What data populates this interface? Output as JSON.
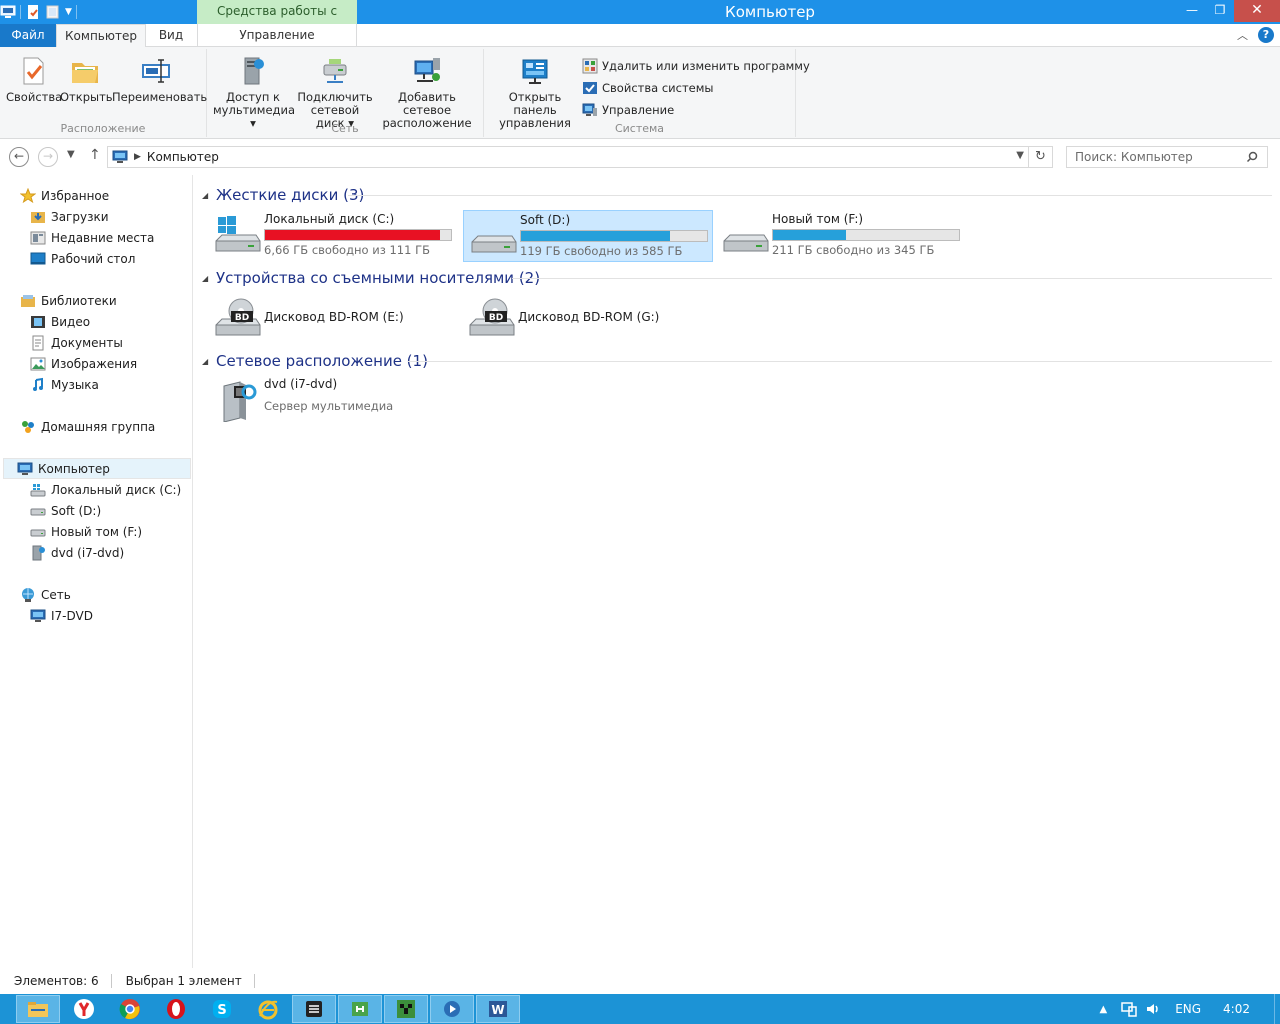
{
  "window": {
    "title": "Компьютер",
    "tools_tab_label": "Средства работы с дисками",
    "minimize": "—",
    "maximize": "❐",
    "close": "✕"
  },
  "tabs": {
    "file": "Файл",
    "computer": "Компьютер",
    "view": "Вид",
    "manage": "Управление",
    "help": "?"
  },
  "ribbon": {
    "location": {
      "label": "Расположение",
      "properties": "Свойства",
      "open": "Открыть",
      "rename": "Переименовать"
    },
    "network": {
      "label": "Сеть",
      "media_access_line1": "Доступ к",
      "media_access_line2": "мультимедиа",
      "map_drive_line1": "Подключить",
      "map_drive_line2": "сетевой диск",
      "add_location_line1": "Добавить сетевое",
      "add_location_line2": "расположение"
    },
    "system": {
      "label": "Система",
      "control_panel_line1": "Открыть панель",
      "control_panel_line2": "управления",
      "uninstall": "Удалить или изменить программу",
      "system_properties": "Свойства системы",
      "manage": "Управление"
    }
  },
  "address": {
    "crumb": "Компьютер",
    "search_placeholder": "Поиск: Компьютер"
  },
  "nav": {
    "favorites": "Избранное",
    "downloads": "Загрузки",
    "recent": "Недавние места",
    "desktop": "Рабочий стол",
    "libraries": "Библиотеки",
    "video": "Видео",
    "documents": "Документы",
    "pictures": "Изображения",
    "music": "Музыка",
    "homegroup": "Домашняя группа",
    "computer": "Компьютер",
    "drive_c": "Локальный диск (C:)",
    "drive_d": "Soft (D:)",
    "drive_f": "Новый том (F:)",
    "dvd": "dvd (i7-dvd)",
    "network": "Сеть",
    "i7dvd": "I7-DVD"
  },
  "groups": {
    "hard_disks": "Жесткие диски (3)",
    "removable": "Устройства со съемными носителями (2)",
    "network": "Сетевое расположение (1)"
  },
  "drives": [
    {
      "name": "Локальный диск (C:)",
      "free_text": "6,66 ГБ свободно из 111 ГБ",
      "used_fraction": 0.94,
      "bar_color": "#e81123"
    },
    {
      "name": "Soft (D:)",
      "free_text": "119 ГБ свободно из 585 ГБ",
      "used_fraction": 0.8,
      "bar_color": "#26a0da"
    },
    {
      "name": "Новый том (F:)",
      "free_text": "211 ГБ свободно из 345 ГБ",
      "used_fraction": 0.39,
      "bar_color": "#26a0da"
    }
  ],
  "removable_devices": [
    {
      "name": "Дисковод BD-ROM (E:)",
      "badge": "BD"
    },
    {
      "name": "Дисковод BD-ROM (G:)",
      "badge": "BD"
    }
  ],
  "network_locations": [
    {
      "name": "dvd (i7-dvd)",
      "subtitle": "Сервер мультимедиа"
    }
  ],
  "status": {
    "items": "Элементов: 6",
    "selected": "Выбран 1 элемент"
  },
  "taskbar": {
    "language": "ENG",
    "time": "4:02",
    "apps": [
      "file-explorer",
      "yandex-browser",
      "chrome",
      "opera",
      "skype",
      "internet-explorer",
      "notepad-app",
      "remote-tool",
      "minecraft",
      "media-app",
      "word"
    ]
  }
}
